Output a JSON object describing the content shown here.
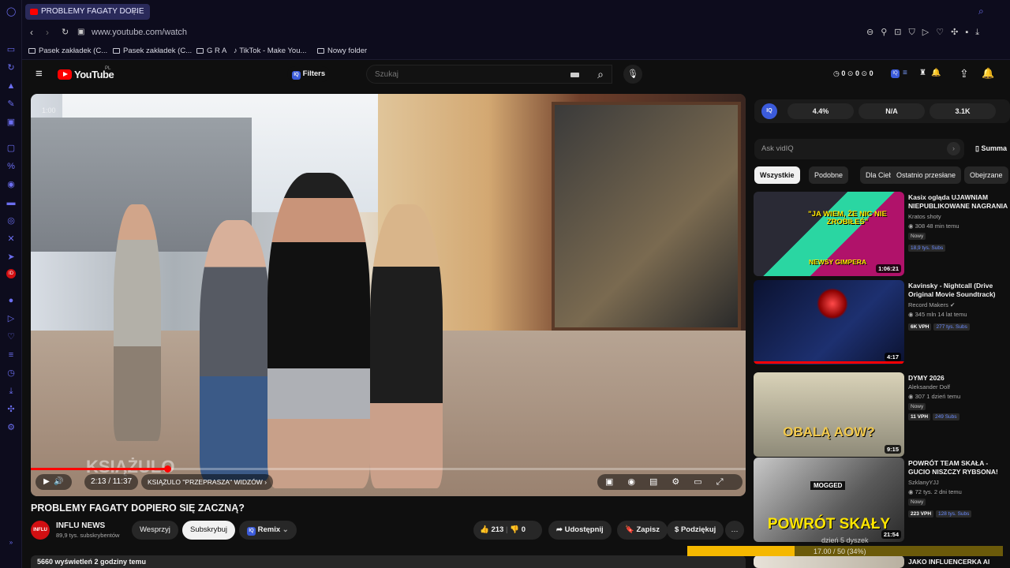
{
  "browser": {
    "tab_title": "PROBLEMY FAGATY DOPIE",
    "url": "www.youtube.com/watch",
    "bookmarks": [
      "Pasek zakładek (C...",
      "Pasek zakładek (C...",
      "G R A",
      "TikTok - Make You...",
      "Nowy folder"
    ]
  },
  "youtube": {
    "logo": "YouTube",
    "logo_region": "PL",
    "filters_label": "Filters",
    "search_placeholder": "Szukaj",
    "header_counts": [
      "0",
      "0",
      "0"
    ]
  },
  "player": {
    "corner_time": "1:00",
    "time": "2:13 / 11:37",
    "chapter": "KSIĄŻULO \"PRZEPRASZA\" WIDZÓW",
    "progress_fraction": 0.191,
    "watermark": "KSIĄŻULO"
  },
  "video": {
    "title": "PROBLEMY FAGATY DOPIERO SIĘ ZACZNĄ?",
    "channel_name": "INFLU NEWS",
    "subscribers": "89,9 tys. subskrybentów",
    "avatar_text": "INFLU",
    "support_label": "Wesprzyj",
    "subscribe_label": "Subskrybuj",
    "remix_label": "Remix",
    "likes": "213",
    "dislikes": "0",
    "share_label": "Udostępnij",
    "save_label": "Zapisz",
    "thanks_label": "Podziękuj",
    "views_line": "5660 wyświetleń  2 godziny temu"
  },
  "vidiq": {
    "stats": [
      "4.4%",
      "N/A",
      "3.1K"
    ],
    "ask_placeholder": "Ask vidIQ",
    "summary_label": "Summa"
  },
  "chips": [
    "Wszystkie",
    "Podobne",
    "Dla Ciebie",
    "Ostatnio przesłane",
    "Obejrzane"
  ],
  "recommendations": [
    {
      "title": "Kasix ogląda UJAWNIAM NIEPUBLIKOWANE NAGRANIA ...",
      "channel": "Kratos shoty",
      "meta": "308  48 min temu",
      "badge": "Nowy",
      "tags": [
        "18,9 tys. Subs"
      ],
      "duration": "1:06:21",
      "thumb_text": "\"JA WIEM, ŻE NIC NIE ZROBIŁEŚ\"",
      "thumb_sub": "NEWSY GIMPERA"
    },
    {
      "title": "Kavinsky - Nightcall (Drive Original Movie Soundtrack) (Official Audio)",
      "channel": "Record Makers",
      "meta": "345 mln  14 lat temu",
      "badge": "",
      "tags": [
        "6K VPH",
        "277 tys. Subs"
      ],
      "duration": "4:17",
      "thumb_text": "",
      "thumb_sub": ""
    },
    {
      "title": "DYMY 2026",
      "channel": "Aleksander Dolf",
      "meta": "307  1 dzień temu",
      "badge": "Nowy",
      "tags": [
        "11 VPH",
        "249 Subs"
      ],
      "duration": "9:15",
      "thumb_text": "OBALĄ AOW?",
      "thumb_sub": ""
    },
    {
      "title": "POWRÓT TEAM SKAŁA - GUCIO NISZCZY RYBSONA! PASHA ...",
      "channel": "SzklanyYJJ",
      "meta": "72 tys.  2 dni temu",
      "badge": "Nowy",
      "tags": [
        "223 VPH",
        "128 tys. Subs"
      ],
      "duration": "21:54",
      "thumb_text": "POWRÓT SKAŁY",
      "thumb_sub": "MOGGED"
    },
    {
      "title": "JAKO INFLUENCERKA AI",
      "channel": "",
      "meta": "",
      "badge": "",
      "tags": [],
      "duration": "",
      "thumb_text": "",
      "thumb_sub": ""
    }
  ],
  "download": {
    "line1": "dzień 5 dyszek",
    "line2": "17.00 / 50 (34%)",
    "fraction": 0.34
  },
  "colors": {
    "accent": "#ff0000",
    "vidiq": "#3b5bdb",
    "browser_accent": "#6b6ef0",
    "download": "#f5b800"
  }
}
